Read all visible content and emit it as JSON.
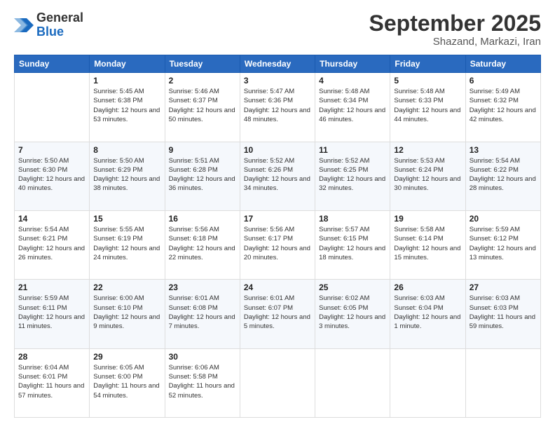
{
  "header": {
    "logo": {
      "general": "General",
      "blue": "Blue"
    },
    "title": "September 2025",
    "subtitle": "Shazand, Markazi, Iran"
  },
  "weekdays": [
    "Sunday",
    "Monday",
    "Tuesday",
    "Wednesday",
    "Thursday",
    "Friday",
    "Saturday"
  ],
  "weeks": [
    [
      {
        "day": null
      },
      {
        "day": 1,
        "sunrise": "5:45 AM",
        "sunset": "6:38 PM",
        "daylight": "12 hours and 53 minutes."
      },
      {
        "day": 2,
        "sunrise": "5:46 AM",
        "sunset": "6:37 PM",
        "daylight": "12 hours and 50 minutes."
      },
      {
        "day": 3,
        "sunrise": "5:47 AM",
        "sunset": "6:36 PM",
        "daylight": "12 hours and 48 minutes."
      },
      {
        "day": 4,
        "sunrise": "5:48 AM",
        "sunset": "6:34 PM",
        "daylight": "12 hours and 46 minutes."
      },
      {
        "day": 5,
        "sunrise": "5:48 AM",
        "sunset": "6:33 PM",
        "daylight": "12 hours and 44 minutes."
      },
      {
        "day": 6,
        "sunrise": "5:49 AM",
        "sunset": "6:32 PM",
        "daylight": "12 hours and 42 minutes."
      }
    ],
    [
      {
        "day": 7,
        "sunrise": "5:50 AM",
        "sunset": "6:30 PM",
        "daylight": "12 hours and 40 minutes."
      },
      {
        "day": 8,
        "sunrise": "5:50 AM",
        "sunset": "6:29 PM",
        "daylight": "12 hours and 38 minutes."
      },
      {
        "day": 9,
        "sunrise": "5:51 AM",
        "sunset": "6:28 PM",
        "daylight": "12 hours and 36 minutes."
      },
      {
        "day": 10,
        "sunrise": "5:52 AM",
        "sunset": "6:26 PM",
        "daylight": "12 hours and 34 minutes."
      },
      {
        "day": 11,
        "sunrise": "5:52 AM",
        "sunset": "6:25 PM",
        "daylight": "12 hours and 32 minutes."
      },
      {
        "day": 12,
        "sunrise": "5:53 AM",
        "sunset": "6:24 PM",
        "daylight": "12 hours and 30 minutes."
      },
      {
        "day": 13,
        "sunrise": "5:54 AM",
        "sunset": "6:22 PM",
        "daylight": "12 hours and 28 minutes."
      }
    ],
    [
      {
        "day": 14,
        "sunrise": "5:54 AM",
        "sunset": "6:21 PM",
        "daylight": "12 hours and 26 minutes."
      },
      {
        "day": 15,
        "sunrise": "5:55 AM",
        "sunset": "6:19 PM",
        "daylight": "12 hours and 24 minutes."
      },
      {
        "day": 16,
        "sunrise": "5:56 AM",
        "sunset": "6:18 PM",
        "daylight": "12 hours and 22 minutes."
      },
      {
        "day": 17,
        "sunrise": "5:56 AM",
        "sunset": "6:17 PM",
        "daylight": "12 hours and 20 minutes."
      },
      {
        "day": 18,
        "sunrise": "5:57 AM",
        "sunset": "6:15 PM",
        "daylight": "12 hours and 18 minutes."
      },
      {
        "day": 19,
        "sunrise": "5:58 AM",
        "sunset": "6:14 PM",
        "daylight": "12 hours and 15 minutes."
      },
      {
        "day": 20,
        "sunrise": "5:59 AM",
        "sunset": "6:12 PM",
        "daylight": "12 hours and 13 minutes."
      }
    ],
    [
      {
        "day": 21,
        "sunrise": "5:59 AM",
        "sunset": "6:11 PM",
        "daylight": "12 hours and 11 minutes."
      },
      {
        "day": 22,
        "sunrise": "6:00 AM",
        "sunset": "6:10 PM",
        "daylight": "12 hours and 9 minutes."
      },
      {
        "day": 23,
        "sunrise": "6:01 AM",
        "sunset": "6:08 PM",
        "daylight": "12 hours and 7 minutes."
      },
      {
        "day": 24,
        "sunrise": "6:01 AM",
        "sunset": "6:07 PM",
        "daylight": "12 hours and 5 minutes."
      },
      {
        "day": 25,
        "sunrise": "6:02 AM",
        "sunset": "6:05 PM",
        "daylight": "12 hours and 3 minutes."
      },
      {
        "day": 26,
        "sunrise": "6:03 AM",
        "sunset": "6:04 PM",
        "daylight": "12 hours and 1 minute."
      },
      {
        "day": 27,
        "sunrise": "6:03 AM",
        "sunset": "6:03 PM",
        "daylight": "11 hours and 59 minutes."
      }
    ],
    [
      {
        "day": 28,
        "sunrise": "6:04 AM",
        "sunset": "6:01 PM",
        "daylight": "11 hours and 57 minutes."
      },
      {
        "day": 29,
        "sunrise": "6:05 AM",
        "sunset": "6:00 PM",
        "daylight": "11 hours and 54 minutes."
      },
      {
        "day": 30,
        "sunrise": "6:06 AM",
        "sunset": "5:58 PM",
        "daylight": "11 hours and 52 minutes."
      },
      {
        "day": null
      },
      {
        "day": null
      },
      {
        "day": null
      },
      {
        "day": null
      }
    ]
  ]
}
